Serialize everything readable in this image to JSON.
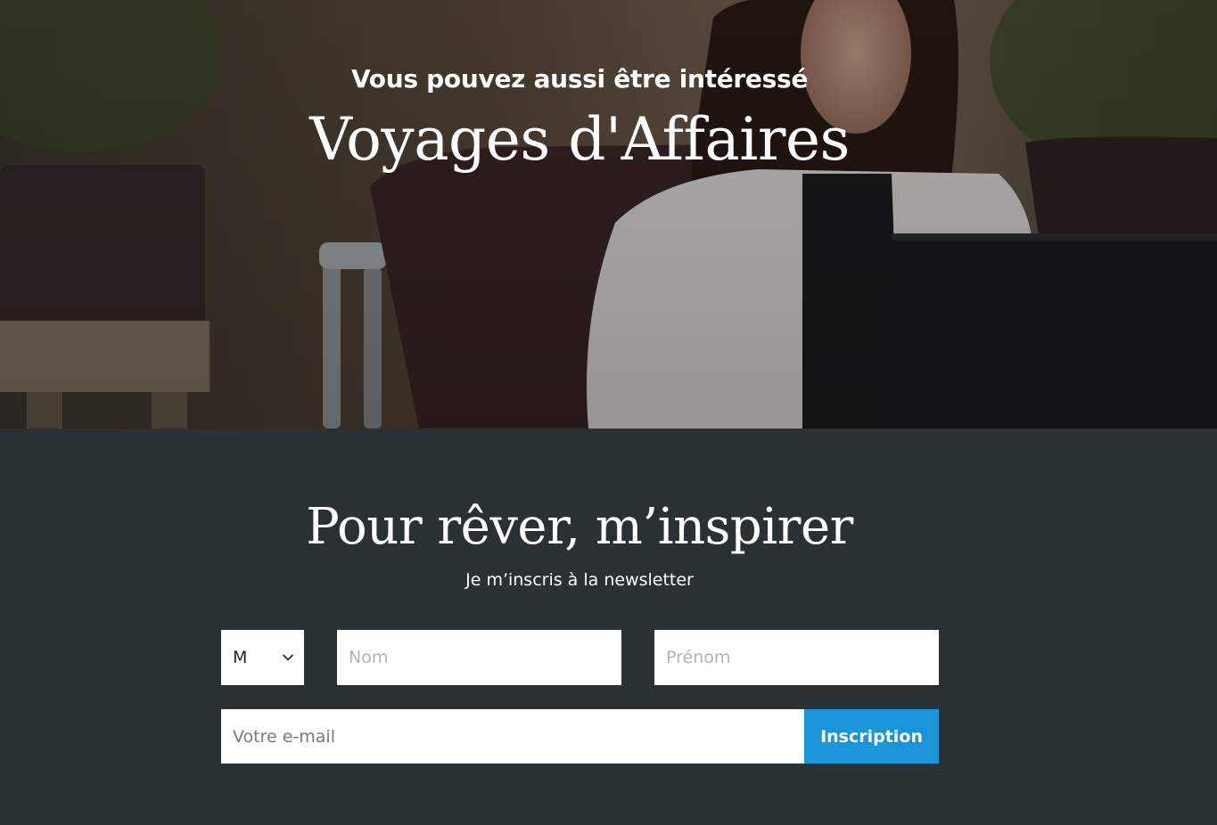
{
  "hero": {
    "kicker": "Vous pouvez aussi être intéressé",
    "title": "Voyages d'Affaires",
    "image_alt": "Femme souriante travaillant sur un ordinateur portable"
  },
  "newsletter": {
    "title": "Pour rêver, m’inspirer",
    "subtitle": "Je m’inscris à la newsletter",
    "civility": {
      "selected": "M",
      "icon": "chevron-down-icon"
    },
    "last_name": {
      "value": "",
      "placeholder": "Nom"
    },
    "first_name": {
      "value": "",
      "placeholder": "Prénom"
    },
    "email": {
      "value": "",
      "placeholder": "Votre e-mail"
    },
    "submit_label": "Inscription"
  },
  "colors": {
    "section_background": "#2a3135",
    "button_accent": "#1a95d9",
    "text_light": "#ffffff"
  }
}
